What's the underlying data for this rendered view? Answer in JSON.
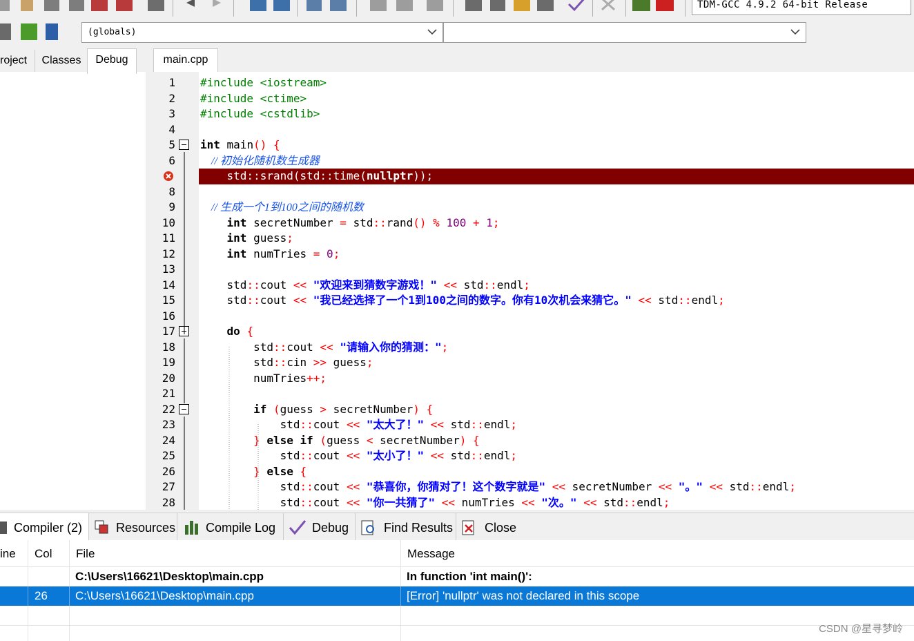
{
  "toolbar": {
    "compiler_select": "TDM-GCC 4.9.2 64-bit Release",
    "globals_combo": "(globals)",
    "second_combo": ""
  },
  "left_tabs": [
    "roject",
    "Classes",
    "Debug"
  ],
  "editor_tab": "main.cpp",
  "code_lines": [
    {
      "n": "1",
      "parts": [
        {
          "t": "#include <iostream>",
          "c": "pp"
        }
      ]
    },
    {
      "n": "2",
      "parts": [
        {
          "t": "#include <ctime>",
          "c": "pp"
        }
      ]
    },
    {
      "n": "3",
      "parts": [
        {
          "t": "#include <cstdlib>",
          "c": "pp"
        }
      ]
    },
    {
      "n": "4",
      "parts": []
    },
    {
      "n": "5",
      "fold": true,
      "parts": [
        {
          "t": "int",
          "c": "kw"
        },
        {
          "t": " main",
          "c": "pl"
        },
        {
          "t": "()",
          "c": "op"
        },
        {
          "t": " ",
          "c": "pl"
        },
        {
          "t": "{",
          "c": "op"
        }
      ]
    },
    {
      "n": "6",
      "parts": [
        {
          "t": "    // 初始化随机数生成器",
          "c": "cm"
        }
      ]
    },
    {
      "n": "7",
      "error": true,
      "parts": [
        {
          "t": "    std::srand(std::time",
          "c": "pl"
        },
        {
          "t": "(",
          "c": "op"
        },
        {
          "t": "nullptr",
          "c": "kw"
        },
        {
          "t": ")",
          "c": "op"
        },
        {
          "t": ");",
          "c": "pl"
        }
      ]
    },
    {
      "n": "8",
      "parts": []
    },
    {
      "n": "9",
      "parts": [
        {
          "t": "    // 生成一个1到100之间的随机数",
          "c": "cm"
        }
      ]
    },
    {
      "n": "10",
      "parts": [
        {
          "t": "    ",
          "c": "pl"
        },
        {
          "t": "int",
          "c": "kw"
        },
        {
          "t": " secretNumber ",
          "c": "pl"
        },
        {
          "t": "=",
          "c": "op"
        },
        {
          "t": " std",
          "c": "pl"
        },
        {
          "t": "::",
          "c": "op"
        },
        {
          "t": "rand",
          "c": "pl"
        },
        {
          "t": "()",
          "c": "op"
        },
        {
          "t": " ",
          "c": "pl"
        },
        {
          "t": "%",
          "c": "op"
        },
        {
          "t": " ",
          "c": "pl"
        },
        {
          "t": "100",
          "c": "num"
        },
        {
          "t": " ",
          "c": "pl"
        },
        {
          "t": "+",
          "c": "op"
        },
        {
          "t": " ",
          "c": "pl"
        },
        {
          "t": "1",
          "c": "num"
        },
        {
          "t": ";",
          "c": "op"
        }
      ]
    },
    {
      "n": "11",
      "parts": [
        {
          "t": "    ",
          "c": "pl"
        },
        {
          "t": "int",
          "c": "kw"
        },
        {
          "t": " guess",
          "c": "pl"
        },
        {
          "t": ";",
          "c": "op"
        }
      ]
    },
    {
      "n": "12",
      "parts": [
        {
          "t": "    ",
          "c": "pl"
        },
        {
          "t": "int",
          "c": "kw"
        },
        {
          "t": " numTries ",
          "c": "pl"
        },
        {
          "t": "=",
          "c": "op"
        },
        {
          "t": " ",
          "c": "pl"
        },
        {
          "t": "0",
          "c": "num"
        },
        {
          "t": ";",
          "c": "op"
        }
      ]
    },
    {
      "n": "13",
      "parts": []
    },
    {
      "n": "14",
      "parts": [
        {
          "t": "    std",
          "c": "pl"
        },
        {
          "t": "::",
          "c": "op"
        },
        {
          "t": "cout ",
          "c": "pl"
        },
        {
          "t": "<<",
          "c": "op"
        },
        {
          "t": " ",
          "c": "pl"
        },
        {
          "t": "\"欢迎来到猜数字游戏！\"",
          "c": "str"
        },
        {
          "t": " ",
          "c": "pl"
        },
        {
          "t": "<<",
          "c": "op"
        },
        {
          "t": " std",
          "c": "pl"
        },
        {
          "t": "::",
          "c": "op"
        },
        {
          "t": "endl",
          "c": "pl"
        },
        {
          "t": ";",
          "c": "op"
        }
      ]
    },
    {
      "n": "15",
      "parts": [
        {
          "t": "    std",
          "c": "pl"
        },
        {
          "t": "::",
          "c": "op"
        },
        {
          "t": "cout ",
          "c": "pl"
        },
        {
          "t": "<<",
          "c": "op"
        },
        {
          "t": " ",
          "c": "pl"
        },
        {
          "t": "\"我已经选择了一个1到100之间的数字。你有10次机会来猜它。\"",
          "c": "str"
        },
        {
          "t": " ",
          "c": "pl"
        },
        {
          "t": "<<",
          "c": "op"
        },
        {
          "t": " std",
          "c": "pl"
        },
        {
          "t": "::",
          "c": "op"
        },
        {
          "t": "endl",
          "c": "pl"
        },
        {
          "t": ";",
          "c": "op"
        }
      ]
    },
    {
      "n": "16",
      "parts": []
    },
    {
      "n": "17",
      "fold": true,
      "parts": [
        {
          "t": "    ",
          "c": "pl"
        },
        {
          "t": "do",
          "c": "kw"
        },
        {
          "t": " ",
          "c": "pl"
        },
        {
          "t": "{",
          "c": "op"
        }
      ]
    },
    {
      "n": "18",
      "parts": [
        {
          "t": "        std",
          "c": "pl"
        },
        {
          "t": "::",
          "c": "op"
        },
        {
          "t": "cout ",
          "c": "pl"
        },
        {
          "t": "<<",
          "c": "op"
        },
        {
          "t": " ",
          "c": "pl"
        },
        {
          "t": "\"请输入你的猜测：\"",
          "c": "str"
        },
        {
          "t": ";",
          "c": "op"
        }
      ]
    },
    {
      "n": "19",
      "parts": [
        {
          "t": "        std",
          "c": "pl"
        },
        {
          "t": "::",
          "c": "op"
        },
        {
          "t": "cin ",
          "c": "pl"
        },
        {
          "t": ">>",
          "c": "op"
        },
        {
          "t": " guess",
          "c": "pl"
        },
        {
          "t": ";",
          "c": "op"
        }
      ]
    },
    {
      "n": "20",
      "parts": [
        {
          "t": "        numTries",
          "c": "pl"
        },
        {
          "t": "++;",
          "c": "op"
        }
      ]
    },
    {
      "n": "21",
      "parts": []
    },
    {
      "n": "22",
      "fold": true,
      "parts": [
        {
          "t": "        ",
          "c": "pl"
        },
        {
          "t": "if",
          "c": "kw"
        },
        {
          "t": " ",
          "c": "pl"
        },
        {
          "t": "(",
          "c": "op"
        },
        {
          "t": "guess ",
          "c": "pl"
        },
        {
          "t": ">",
          "c": "op"
        },
        {
          "t": " secretNumber",
          "c": "pl"
        },
        {
          "t": ")",
          "c": "op"
        },
        {
          "t": " ",
          "c": "pl"
        },
        {
          "t": "{",
          "c": "op"
        }
      ]
    },
    {
      "n": "23",
      "parts": [
        {
          "t": "            std",
          "c": "pl"
        },
        {
          "t": "::",
          "c": "op"
        },
        {
          "t": "cout ",
          "c": "pl"
        },
        {
          "t": "<<",
          "c": "op"
        },
        {
          "t": " ",
          "c": "pl"
        },
        {
          "t": "\"太大了！\"",
          "c": "str"
        },
        {
          "t": " ",
          "c": "pl"
        },
        {
          "t": "<<",
          "c": "op"
        },
        {
          "t": " std",
          "c": "pl"
        },
        {
          "t": "::",
          "c": "op"
        },
        {
          "t": "endl",
          "c": "pl"
        },
        {
          "t": ";",
          "c": "op"
        }
      ]
    },
    {
      "n": "24",
      "parts": [
        {
          "t": "        ",
          "c": "pl"
        },
        {
          "t": "}",
          "c": "op"
        },
        {
          "t": " ",
          "c": "pl"
        },
        {
          "t": "else if",
          "c": "kw"
        },
        {
          "t": " ",
          "c": "pl"
        },
        {
          "t": "(",
          "c": "op"
        },
        {
          "t": "guess ",
          "c": "pl"
        },
        {
          "t": "<",
          "c": "op"
        },
        {
          "t": " secretNumber",
          "c": "pl"
        },
        {
          "t": ")",
          "c": "op"
        },
        {
          "t": " ",
          "c": "pl"
        },
        {
          "t": "{",
          "c": "op"
        }
      ]
    },
    {
      "n": "25",
      "parts": [
        {
          "t": "            std",
          "c": "pl"
        },
        {
          "t": "::",
          "c": "op"
        },
        {
          "t": "cout ",
          "c": "pl"
        },
        {
          "t": "<<",
          "c": "op"
        },
        {
          "t": " ",
          "c": "pl"
        },
        {
          "t": "\"太小了！\"",
          "c": "str"
        },
        {
          "t": " ",
          "c": "pl"
        },
        {
          "t": "<<",
          "c": "op"
        },
        {
          "t": " std",
          "c": "pl"
        },
        {
          "t": "::",
          "c": "op"
        },
        {
          "t": "endl",
          "c": "pl"
        },
        {
          "t": ";",
          "c": "op"
        }
      ]
    },
    {
      "n": "26",
      "parts": [
        {
          "t": "        ",
          "c": "pl"
        },
        {
          "t": "}",
          "c": "op"
        },
        {
          "t": " ",
          "c": "pl"
        },
        {
          "t": "else",
          "c": "kw"
        },
        {
          "t": " ",
          "c": "pl"
        },
        {
          "t": "{",
          "c": "op"
        }
      ]
    },
    {
      "n": "27",
      "parts": [
        {
          "t": "            std",
          "c": "pl"
        },
        {
          "t": "::",
          "c": "op"
        },
        {
          "t": "cout ",
          "c": "pl"
        },
        {
          "t": "<<",
          "c": "op"
        },
        {
          "t": " ",
          "c": "pl"
        },
        {
          "t": "\"恭喜你，你猜对了！这个数字就是\"",
          "c": "str"
        },
        {
          "t": " ",
          "c": "pl"
        },
        {
          "t": "<<",
          "c": "op"
        },
        {
          "t": " secretNumber ",
          "c": "pl"
        },
        {
          "t": "<<",
          "c": "op"
        },
        {
          "t": " ",
          "c": "pl"
        },
        {
          "t": "\"。\"",
          "c": "str"
        },
        {
          "t": " ",
          "c": "pl"
        },
        {
          "t": "<<",
          "c": "op"
        },
        {
          "t": " std",
          "c": "pl"
        },
        {
          "t": "::",
          "c": "op"
        },
        {
          "t": "endl",
          "c": "pl"
        },
        {
          "t": ";",
          "c": "op"
        }
      ]
    },
    {
      "n": "28",
      "parts": [
        {
          "t": "            std",
          "c": "pl"
        },
        {
          "t": "::",
          "c": "op"
        },
        {
          "t": "cout ",
          "c": "pl"
        },
        {
          "t": "<<",
          "c": "op"
        },
        {
          "t": " ",
          "c": "pl"
        },
        {
          "t": "\"你一共猜了\"",
          "c": "str"
        },
        {
          "t": " ",
          "c": "pl"
        },
        {
          "t": "<<",
          "c": "op"
        },
        {
          "t": " numTries ",
          "c": "pl"
        },
        {
          "t": "<<",
          "c": "op"
        },
        {
          "t": " ",
          "c": "pl"
        },
        {
          "t": "\"次。\"",
          "c": "str"
        },
        {
          "t": " ",
          "c": "pl"
        },
        {
          "t": "<<",
          "c": "op"
        },
        {
          "t": " std",
          "c": "pl"
        },
        {
          "t": "::",
          "c": "op"
        },
        {
          "t": "endl",
          "c": "pl"
        },
        {
          "t": ";",
          "c": "op"
        }
      ]
    }
  ],
  "bottom_tabs": {
    "compiler": "Compiler (2)",
    "resources": "Resources",
    "compile_log": "Compile Log",
    "debug": "Debug",
    "find_results": "Find Results",
    "close": "Close"
  },
  "messages": {
    "headers": {
      "line": "ine",
      "col": "Col",
      "file": "File",
      "message": "Message"
    },
    "rows": [
      {
        "line": "",
        "col": "",
        "file": "C:\\Users\\16621\\Desktop\\main.cpp",
        "message": "In function 'int main()':",
        "bold": true
      },
      {
        "line": "",
        "col": "26",
        "file": "C:\\Users\\16621\\Desktop\\main.cpp",
        "message": "[Error] 'nullptr' was not declared in this scope",
        "selected": true
      }
    ]
  },
  "watermark": "CSDN @星寻梦岭"
}
